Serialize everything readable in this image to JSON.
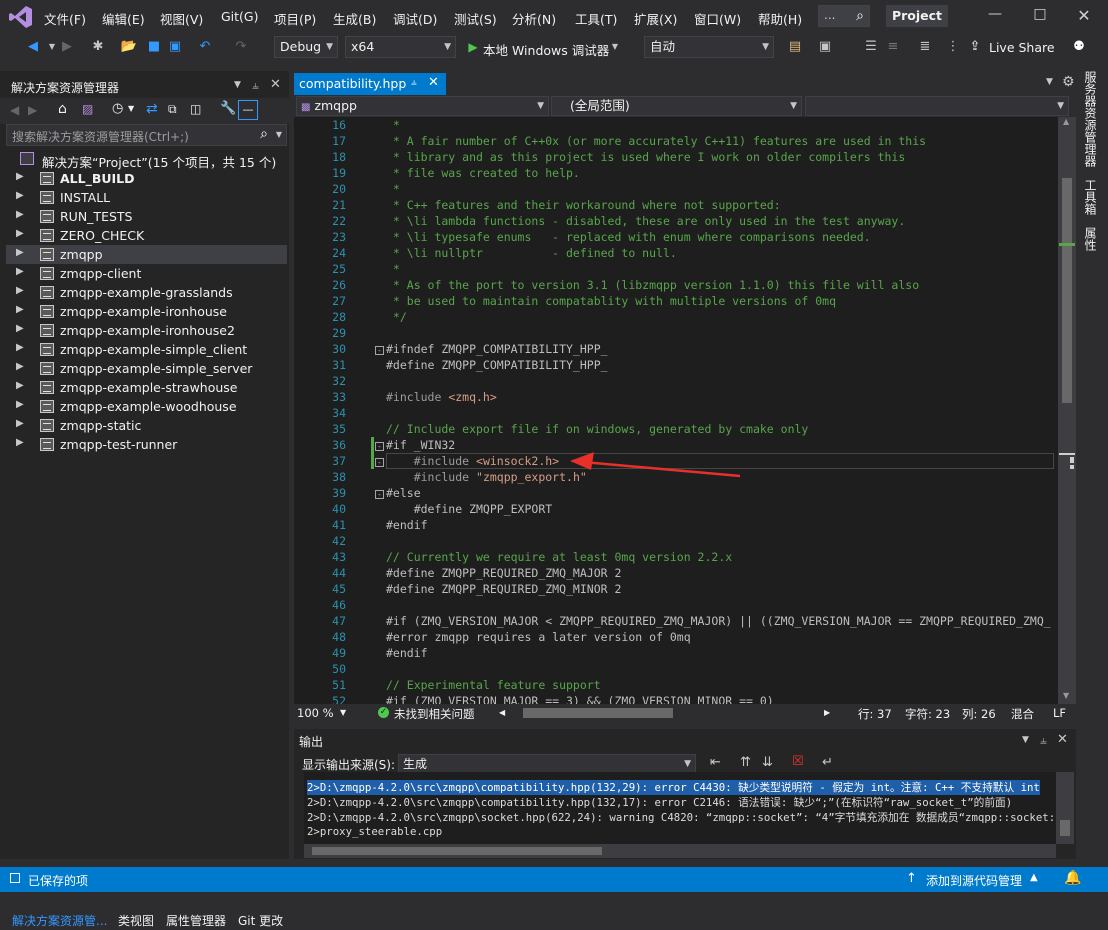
{
  "menu": [
    "文件(F)",
    "编辑(E)",
    "视图(V)",
    "Git(G)",
    "项目(P)",
    "生成(B)",
    "调试(D)",
    "测试(S)",
    "分析(N)",
    "工具(T)",
    "扩展(X)",
    "窗口(W)",
    "帮助(H)"
  ],
  "search_placeholder": "...",
  "project_button": "Project",
  "toolbar": {
    "config": "Debug",
    "platform": "x64",
    "run_label": "本地 Windows 调试器",
    "run_mode": "自动",
    "live_share": "Live Share"
  },
  "solution_explorer": {
    "title": "解决方案资源管理器",
    "search_placeholder": "搜索解决方案资源管理器(Ctrl+;)",
    "solution_label": "解决方案“Project”(15 个项目，共 15 个)",
    "items": [
      {
        "label": "ALL_BUILD",
        "bold": true
      },
      {
        "label": "INSTALL"
      },
      {
        "label": "RUN_TESTS"
      },
      {
        "label": "ZERO_CHECK"
      },
      {
        "label": "zmqpp",
        "selected": true
      },
      {
        "label": "zmqpp-client"
      },
      {
        "label": "zmqpp-example-grasslands"
      },
      {
        "label": "zmqpp-example-ironhouse"
      },
      {
        "label": "zmqpp-example-ironhouse2"
      },
      {
        "label": "zmqpp-example-simple_client"
      },
      {
        "label": "zmqpp-example-simple_server"
      },
      {
        "label": "zmqpp-example-strawhouse"
      },
      {
        "label": "zmqpp-example-woodhouse"
      },
      {
        "label": "zmqpp-static"
      },
      {
        "label": "zmqpp-test-runner"
      }
    ],
    "bottom_tabs": [
      "解决方案资源管...",
      "类视图",
      "属性管理器",
      "Git 更改"
    ]
  },
  "editor": {
    "tab_name": "compatibility.hpp",
    "nav_project": "zmqpp",
    "nav_scope": "(全局范围)",
    "nav_member": "",
    "lines": [
      {
        "n": "16",
        "t": " *",
        "k": "cmt"
      },
      {
        "n": "17",
        "t": " * A fair number of C++0x (or more accurately C++11) features are used in this",
        "k": "cmt"
      },
      {
        "n": "18",
        "t": " * library and as this project is used where I work on older compilers this",
        "k": "cmt"
      },
      {
        "n": "19",
        "t": " * file was created to help.",
        "k": "cmt"
      },
      {
        "n": "20",
        "t": " *",
        "k": "cmt"
      },
      {
        "n": "21",
        "t": " * C++ features and their workaround where not supported:",
        "k": "cmt"
      },
      {
        "n": "22",
        "t": " * \\li lambda functions - disabled, these are only used in the test anyway.",
        "k": "cmt"
      },
      {
        "n": "23",
        "t": " * \\li typesafe enums   - replaced with enum where comparisons needed.",
        "k": "cmt"
      },
      {
        "n": "24",
        "t": " * \\li nullptr          - defined to null.",
        "k": "cmt"
      },
      {
        "n": "25",
        "t": " *",
        "k": "cmt"
      },
      {
        "n": "26",
        "t": " * As of the port to version 3.1 (libzmqpp version 1.1.0) this file will also",
        "k": "cmt"
      },
      {
        "n": "27",
        "t": " * be used to maintain compatablity with multiple versions of 0mq",
        "k": "cmt"
      },
      {
        "n": "28",
        "t": " */",
        "k": "cmt"
      },
      {
        "n": "29",
        "t": "",
        "k": "code"
      },
      {
        "n": "30",
        "t": "#ifndef ZMQPP_COMPATIBILITY_HPP_",
        "k": "pp"
      },
      {
        "n": "31",
        "t": "#define ZMQPP_COMPATIBILITY_HPP_",
        "k": "pp"
      },
      {
        "n": "32",
        "t": "",
        "k": "code"
      },
      {
        "n": "33",
        "t": "#include <zmq.h>",
        "k": "inc"
      },
      {
        "n": "34",
        "t": "",
        "k": "code"
      },
      {
        "n": "35",
        "t": "// Include export file if on windows, generated by cmake only",
        "k": "cmt"
      },
      {
        "n": "36",
        "t": "#if _WIN32",
        "k": "pp"
      },
      {
        "n": "37",
        "t": "    #include <winsock2.h>",
        "k": "inc"
      },
      {
        "n": "38",
        "t": "    #include \"zmqpp_export.h\"",
        "k": "inc"
      },
      {
        "n": "39",
        "t": "#else",
        "k": "pp"
      },
      {
        "n": "40",
        "t": "    #define ZMQPP_EXPORT",
        "k": "pp"
      },
      {
        "n": "41",
        "t": "#endif",
        "k": "pp"
      },
      {
        "n": "42",
        "t": "",
        "k": "code"
      },
      {
        "n": "43",
        "t": "// Currently we require at least 0mq version 2.2.x",
        "k": "cmt"
      },
      {
        "n": "44",
        "t": "#define ZMQPP_REQUIRED_ZMQ_MAJOR 2",
        "k": "pp"
      },
      {
        "n": "45",
        "t": "#define ZMQPP_REQUIRED_ZMQ_MINOR 2",
        "k": "pp"
      },
      {
        "n": "46",
        "t": "",
        "k": "code"
      },
      {
        "n": "47",
        "t": "#if (ZMQ_VERSION_MAJOR < ZMQPP_REQUIRED_ZMQ_MAJOR) || ((ZMQ_VERSION_MAJOR == ZMQPP_REQUIRED_ZMQ_",
        "k": "pp"
      },
      {
        "n": "48",
        "t": "#error zmqpp requires a later version of 0mq",
        "k": "pp"
      },
      {
        "n": "49",
        "t": "#endif",
        "k": "pp"
      },
      {
        "n": "50",
        "t": "",
        "k": "code"
      },
      {
        "n": "51",
        "t": "// Experimental feature support",
        "k": "cmt"
      },
      {
        "n": "52",
        "t": "#if (ZMQ_VERSION_MAJOR == 3) && (ZMQ_VERSION_MINOR == 0)",
        "k": "pp"
      }
    ],
    "status": {
      "zoom": "100 %",
      "issues": "未找到相关问题",
      "row": "行: 37",
      "char": "字符: 23",
      "col": "列: 26",
      "eol_mode": "混合",
      "eol": "LF"
    }
  },
  "right_tabs": [
    "服务器资源管理器",
    "工具箱",
    "属性"
  ],
  "output": {
    "title": "输出",
    "source_label": "显示输出来源(S):",
    "source_value": "生成",
    "lines": [
      {
        "t": "2>D:\\zmqpp-4.2.0\\src\\zmqpp\\compatibility.hpp(132,29): error C4430: 缺少类型说明符 - 假定为 int。注意: C++ 不支持默认 int",
        "hl": true
      },
      {
        "t": "2>D:\\zmqpp-4.2.0\\src\\zmqpp\\compatibility.hpp(132,17): error C2146: 语法错误: 缺少“;”(在标识符“raw_socket_t”的前面)",
        "hl": false
      },
      {
        "t": "2>D:\\zmqpp-4.2.0\\src\\zmqpp\\socket.hpp(622,24): warning C4820: “zmqpp::socket”: “4”字节填充添加在 数据成员“zmqpp::socket::",
        "hl": false
      },
      {
        "t": "2>proxy_steerable.cpp",
        "hl": false
      }
    ]
  },
  "statusbar": {
    "left": "已保存的项",
    "right": "添加到源代码管理"
  },
  "colors": {
    "accent": "#007acc",
    "bg": "#2d2d30",
    "editor_bg": "#1e1e1e",
    "comment": "#57a64a",
    "line_number": "#2b91af",
    "arrow": "#e8302a"
  }
}
